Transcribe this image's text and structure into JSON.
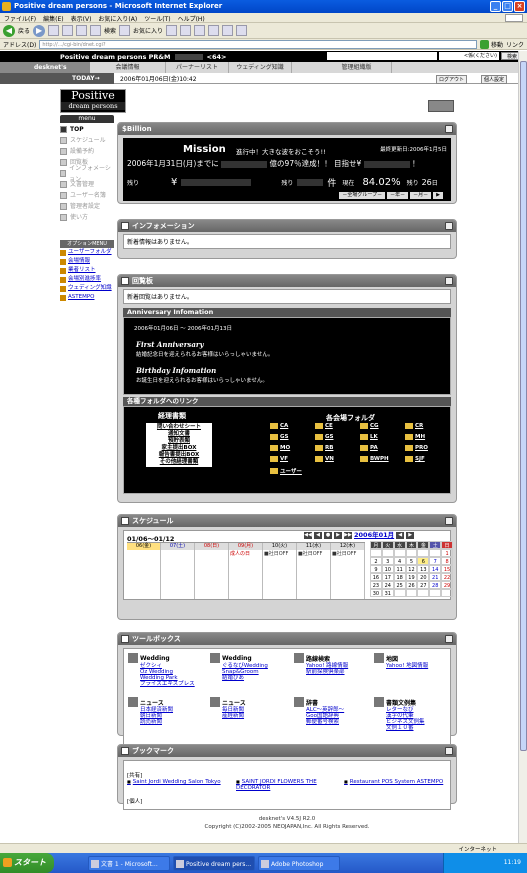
{
  "window": {
    "title": "Positive dream persons - Microsoft Internet Explorer",
    "menu": [
      "ファイル(F)",
      "編集(E)",
      "表示(V)",
      "お気に入り(A)",
      "ツール(T)",
      "ヘルプ(H)"
    ],
    "toolbar": {
      "back": "戻る",
      "search": "検索",
      "favorites": "お気に入り"
    },
    "address_label": "アドレス(D)",
    "address_value": "http://.../cgi-bin/dnet.cgi?",
    "go_label": "移動",
    "links_label": "リンク"
  },
  "header": {
    "title": "Positive dream persons PR&M",
    "count": "<64>",
    "search_select": "<係(ください)",
    "search_button": "検索"
  },
  "nav": {
    "brand": "desknet's",
    "tabs": [
      "会議情報",
      "パーナーリスト",
      "ウェディング知識",
      "管理組織版"
    ]
  },
  "topbar": {
    "today_label": "TODAY→",
    "date": "2006年01月06日(金)10:42",
    "logout": "ログアウト",
    "personal": "個人設定"
  },
  "logo": {
    "line1": "Positive",
    "line2": "dream persons"
  },
  "menu_label": "menu",
  "leftnav": [
    "TOP",
    "スケジュール",
    "設備予約",
    "回覧板",
    "インフォメーション",
    "文書管理",
    "ユーザー名簿",
    "管理者設定",
    "使い方"
  ],
  "option_label": "オプションMENU",
  "optnav": [
    "ユーザーフォルダ",
    "会場情報",
    "業者リスト",
    "会場別進捗率",
    "ウェディング知識",
    "ASTEMPO"
  ],
  "panels": {
    "sbillion": "$Billion",
    "info": "インフォメーション",
    "info_body": "新着情報はありません。",
    "board": "回覧板",
    "board_body": "新着回覧はありません。",
    "anniv_title": "Anniversary Infomation",
    "schedule": "スケジュール",
    "toolbox": "ツールボックス",
    "bookmark": "ブックマーク"
  },
  "mission": {
    "title": "Mission",
    "subtitle": "進行中！大きな波をおこそう!!",
    "updated": "最終更新日:2006年1月5日",
    "line2_left": "2006年1月31日(月)までに",
    "line2_mid": "億の97％達成！！ 目指せ¥",
    "line2_end": "！",
    "remain": "残り",
    "yen": "¥",
    "remain2": "残り",
    "unit": "件",
    "current": "現在",
    "pct": "84.02%",
    "remain3": "残り",
    "days": "26",
    "days_unit": "日",
    "selects": [
      "－全場グループ－",
      "－年－",
      "－月－",
      "▶"
    ]
  },
  "anniv": {
    "daterange": "2006年01月06日 ～ 2006年01月13日",
    "first_title": "First Anniversary",
    "first_text": "結婚記念日を迎えられるお客様はいらっしゃいません。",
    "birthday_title": "Birthday Infomation",
    "birthday_text": "お誕生日を迎えられるお客様はいらっしゃいません。"
  },
  "links": {
    "header": "各種フォルダへのリンク",
    "left_title": "経理書類",
    "left_items": [
      "問い合わせシート",
      "通知文書",
      "預貯表類",
      "家主提出BOX",
      "報告書提出BOX",
      "その他経理書類"
    ],
    "right_title": "各会場フォルダ",
    "folders": [
      "CA",
      "CE",
      "CG",
      "CR",
      "GS",
      "GS",
      "LK",
      "MH",
      "MO",
      "RB",
      "PA",
      "PRO",
      "VF",
      "VN",
      "BWPH",
      "SJF",
      "ユーザー"
    ]
  },
  "schedule": {
    "week_range": "01/06～01/12",
    "month": "2006年01月",
    "days": [
      "06(金)",
      "07(土)",
      "08(日)",
      "09(月)",
      "10(火)",
      "11(水)",
      "12(木)"
    ],
    "events": [
      "",
      "",
      "",
      "成人の日",
      "■社日OFF",
      "■社日OFF",
      "■社日OFF"
    ],
    "cal_head": [
      "月",
      "火",
      "水",
      "木",
      "金",
      "土",
      "日"
    ],
    "cal_rows": [
      [
        "",
        "",
        "",
        "",
        "",
        "",
        "1"
      ],
      [
        "2",
        "3",
        "4",
        "5",
        "6",
        "7",
        "8"
      ],
      [
        "9",
        "10",
        "11",
        "12",
        "13",
        "14",
        "15"
      ],
      [
        "16",
        "17",
        "18",
        "19",
        "20",
        "21",
        "22"
      ],
      [
        "23",
        "24",
        "25",
        "26",
        "27",
        "28",
        "29"
      ],
      [
        "30",
        "31",
        "",
        "",
        "",
        "",
        ""
      ]
    ]
  },
  "toolbox": [
    {
      "head": "Wedding",
      "links": [
        "ゼクシィ",
        "Oz Wedding",
        "Wedding Park",
        "プライズエキスプレス"
      ]
    },
    {
      "head": "Wedding",
      "links": [
        "ぐるなびWedding",
        "Snap&Groom",
        "結婚ぴあ"
      ]
    },
    {
      "head": "路線検索",
      "links": [
        "Yahoo! 路線情報",
        "駅前探険倶楽部"
      ]
    },
    {
      "head": "地図",
      "links": [
        "Yahoo! 地図情報"
      ]
    },
    {
      "head": "ニュース",
      "links": [
        "日本経済新聞",
        "朝日新聞",
        "読売新聞"
      ]
    },
    {
      "head": "ニュース",
      "links": [
        "毎日新聞",
        "産経新聞"
      ]
    },
    {
      "head": "辞書",
      "links": [
        "ALC～英辞郎～",
        "Goo国語辞典",
        "郵便番号検索"
      ]
    },
    {
      "head": "書類文例集",
      "links": [
        "レターなび",
        "漢字の代筆",
        "ビジネス文例集",
        "文例１０番"
      ]
    }
  ],
  "bookmarks": {
    "shared_label": "[共有]",
    "shared": [
      "Saint Jordi Wedding Salon Tokyo",
      "SAINT JORDI FLOWERS THE DECORATOR",
      "Restaurant POS System ASTEMPO"
    ],
    "personal_label": "[個人]"
  },
  "footer": {
    "line1": "desknet's V4.5J R2.0",
    "line2": "Copyright (C)2002-2005 NEOJAPAN,Inc. All Rights Reserved."
  },
  "status": {
    "internet": "インターネット"
  },
  "taskbar": {
    "start": "スタート",
    "tasks": [
      "文書 1 - Microsoft...",
      "Positive dream pers...",
      "Adobe Photoshop"
    ],
    "time": "11:19"
  }
}
